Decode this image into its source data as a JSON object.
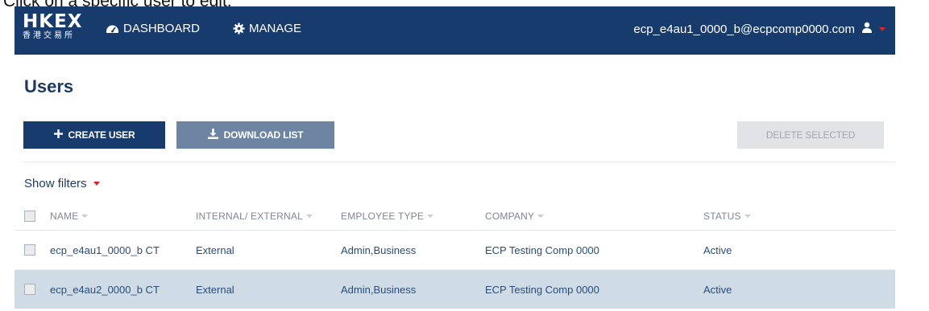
{
  "instruction": "Click on a specific user to edit.",
  "topbar": {
    "logo_en": "HKEX",
    "logo_zh": "香港交易所",
    "nav": [
      {
        "label": "DASHBOARD",
        "icon": "dashboard-icon"
      },
      {
        "label": "MANAGE",
        "icon": "gear-icon"
      }
    ],
    "account_email": "ecp_e4au1_0000_b@ecpcomp0000.com",
    "account_icon": "user-icon"
  },
  "page_title": "Users",
  "buttons": {
    "create": "CREATE USER",
    "download": "DOWNLOAD LIST",
    "delete": "DELETE SELECTED"
  },
  "filters_label": "Show filters",
  "table": {
    "columns": [
      "NAME",
      "INTERNAL/ EXTERNAL",
      "EMPLOYEE TYPE",
      "COMPANY",
      "STATUS"
    ],
    "rows": [
      {
        "name": "ecp_e4au1_0000_b CT",
        "type": "External",
        "employee_type": "Admin,Business",
        "company": "ECP Testing Comp 0000",
        "status": "Active"
      },
      {
        "name": "ecp_e4au2_0000_b CT",
        "type": "External",
        "employee_type": "Admin,Business",
        "company": "ECP Testing Comp 0000",
        "status": "Active"
      }
    ]
  },
  "colors": {
    "navy": "#173b6c",
    "download_button": "#6d85a2",
    "selected_row": "#cfdbe5",
    "accent_red": "#d9252c"
  }
}
